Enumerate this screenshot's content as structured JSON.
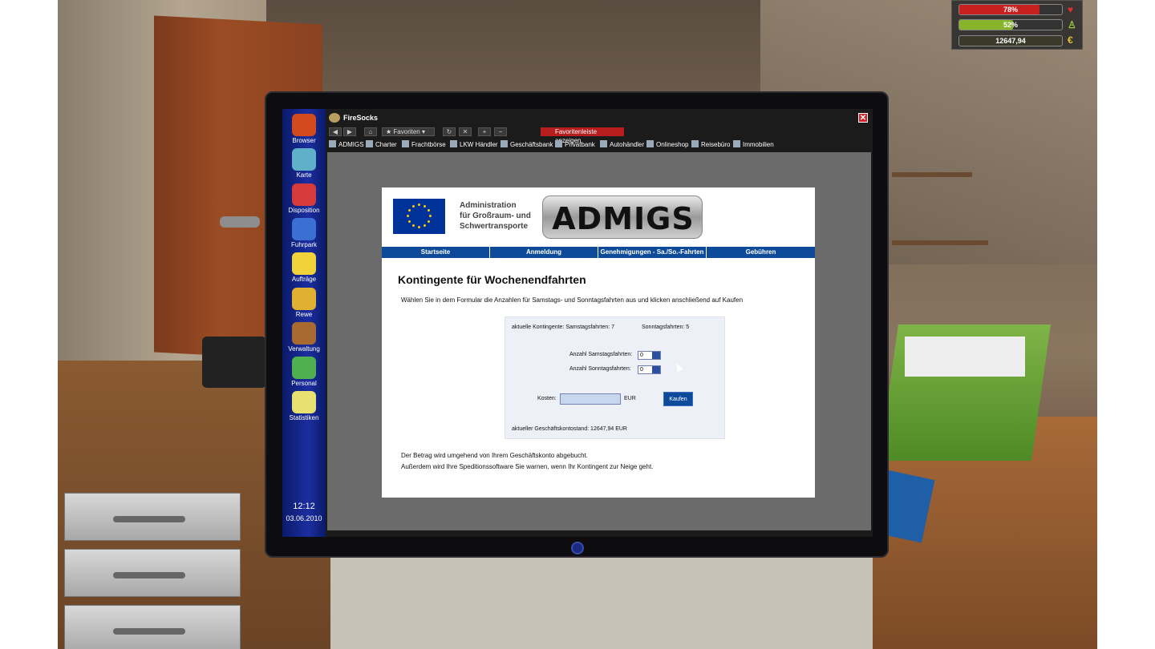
{
  "hud": {
    "health_pct": "78%",
    "health_value": 0.78,
    "fatigue_pct": "52%",
    "fatigue_value": 0.52,
    "money": "12647,94",
    "health_icon": "heart-icon",
    "fatigue_icon": "figure-icon",
    "money_icon": "euro-icon",
    "colors": {
      "health": "#cc2222",
      "fatigue": "#8ab82a"
    }
  },
  "dock": {
    "items": [
      {
        "label": "Browser",
        "icon": "browser-icon",
        "color": "#d24a1d"
      },
      {
        "label": "Karte",
        "icon": "globe-icon",
        "color": "#5fb0c8"
      },
      {
        "label": "Disposition",
        "icon": "molecule-icon",
        "color": "#d73a3a"
      },
      {
        "label": "Fuhrpark",
        "icon": "truck-icon",
        "color": "#3b6fd1"
      },
      {
        "label": "Aufträge",
        "icon": "folder-icon",
        "color": "#f2d23a"
      },
      {
        "label": "Rewe",
        "icon": "money-bag-icon",
        "color": "#e0b030"
      },
      {
        "label": "Verwaltung",
        "icon": "briefcase-icon",
        "color": "#a86a30"
      },
      {
        "label": "Personal",
        "icon": "people-icon",
        "color": "#50b050"
      },
      {
        "label": "Statistiken",
        "icon": "chart-icon",
        "color": "#e8e070"
      }
    ],
    "time": "12:12",
    "date": "03.06.2010"
  },
  "browser": {
    "title": "FireSocks",
    "favorites_label": "Favoriten",
    "favorites_bar_label": "Favoritenleiste anzeigen",
    "bookmarks": [
      "ADMIGS",
      "Charter",
      "Frachtbörse",
      "LKW Händler",
      "Geschäftsbank",
      "Privatbank",
      "Autohändler",
      "Onlineshop",
      "Reisebüro",
      "Immobilien"
    ]
  },
  "page": {
    "org_line1": "Administration",
    "org_line2": "für Großraum- und",
    "org_line3": "Schwertransporte",
    "logo": "ADMIGS",
    "menu": [
      "Startseite",
      "Anmeldung",
      "Genehmigungen - Sa./So.-Fahrten",
      "Gebühren"
    ],
    "title": "Kontingente für Wochenendfahrten",
    "intro": "Wählen Sie in dem Formular die Anzahlen für Samstags- und Sonntagsfahrten aus und klicken anschließend auf Kaufen",
    "form": {
      "current_sat": "aktuelle Kontingente: Samstagsfahrten: 7",
      "current_sun": "Sonntagsfahrten: 5",
      "sat_label": "Anzahl Samstagsfahrten:",
      "sat_value": "0",
      "sun_label": "Anzahl Sonntagsfahrten:",
      "sun_value": "0",
      "cost_label": "Kosten:",
      "currency": "EUR",
      "buy_label": "Kaufen",
      "balance": "aktueller Geschäftskontostand: 12647,94 EUR"
    },
    "footer1": "Der Betrag wird umgehend von Ihrem Geschäftskonto abgebucht.",
    "footer2": "Außerdem wird Ihre Speditionssoftware Sie warnen, wenn Ihr Kontingent zur Neige geht."
  }
}
